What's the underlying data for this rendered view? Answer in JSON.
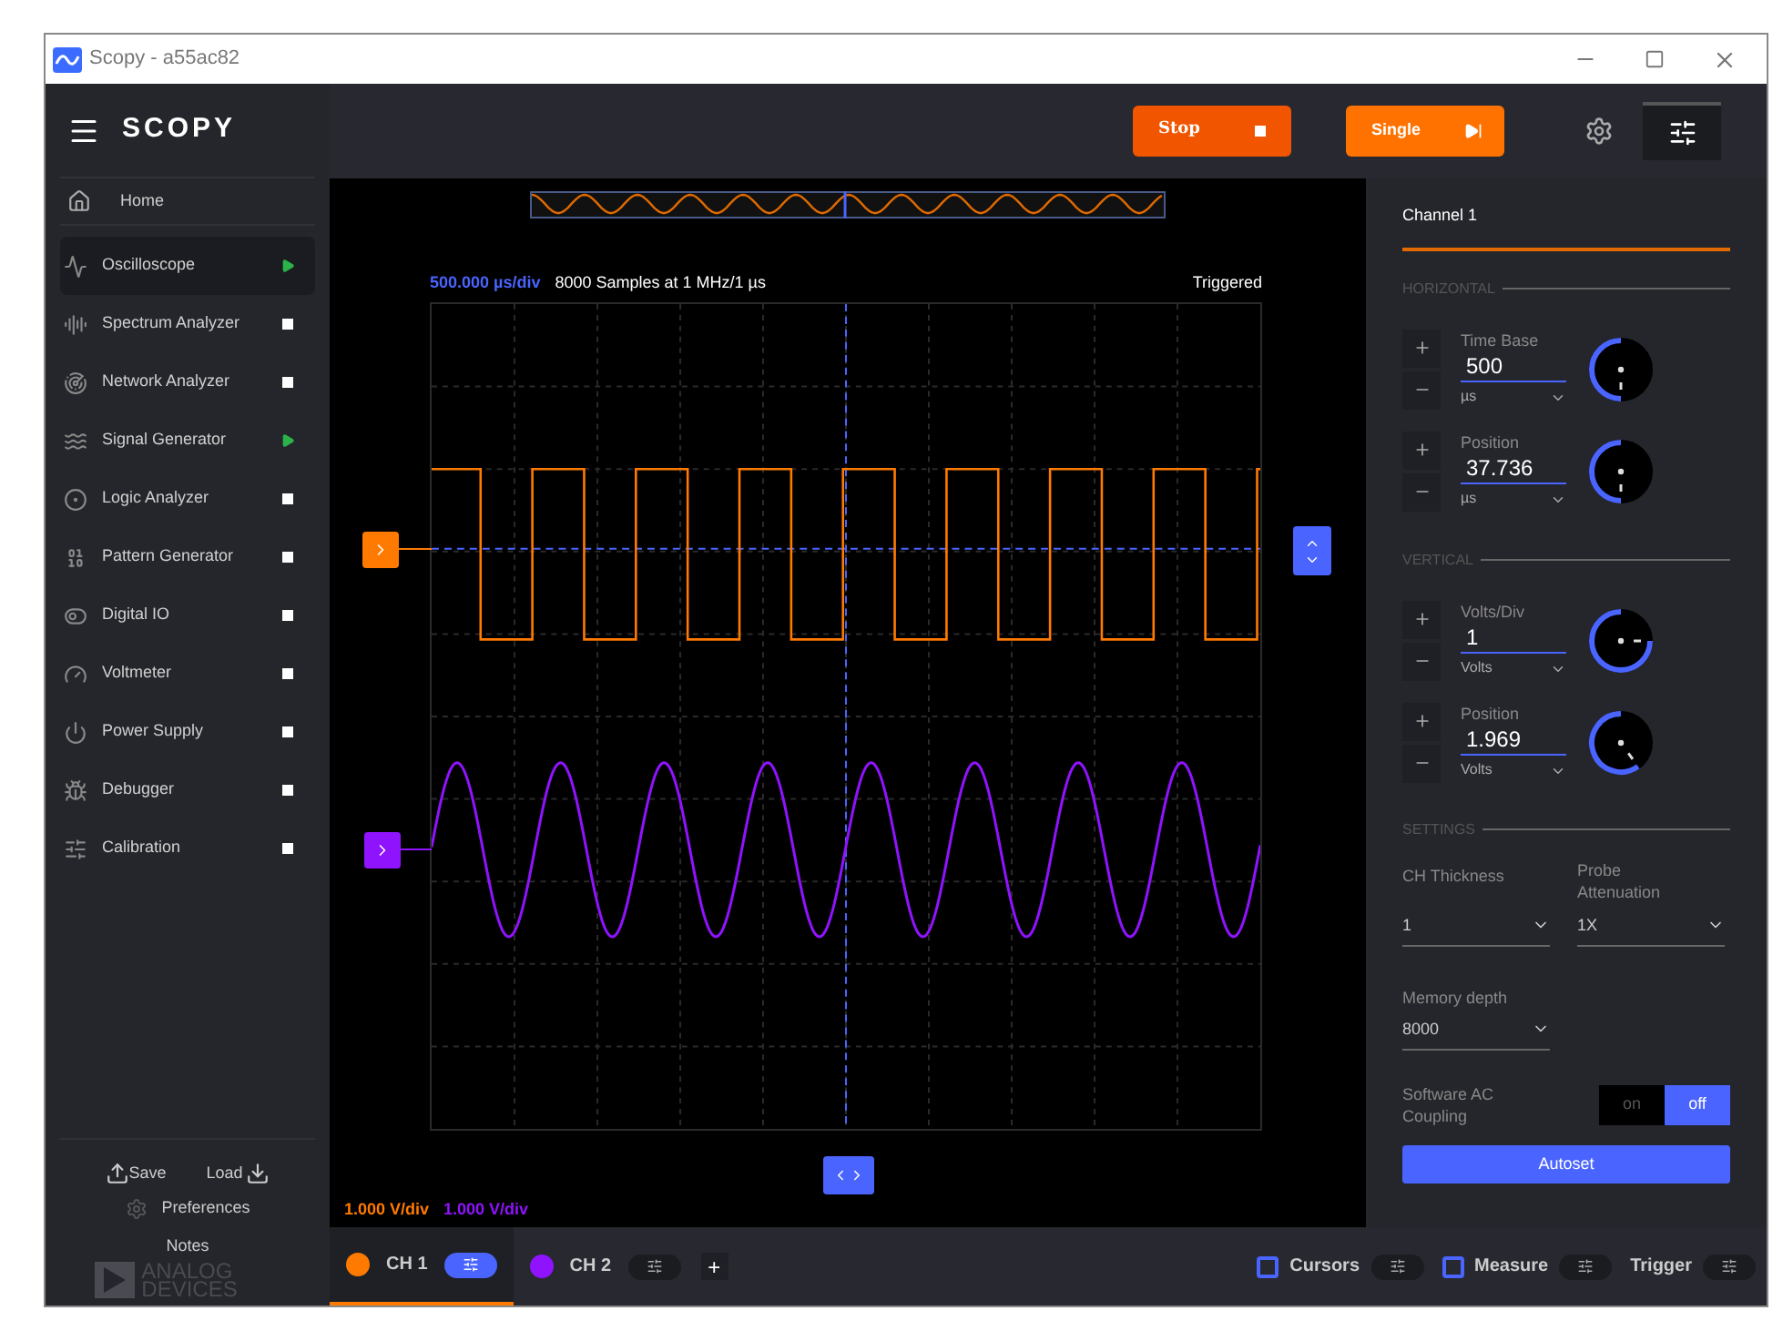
{
  "window": {
    "title": "Scopy - a55ac82"
  },
  "sidebar": {
    "logo": "SCOPY",
    "home": "Home",
    "tools": [
      {
        "label": "Oscilloscope",
        "kind": "oscilloscope",
        "selected": true,
        "running": true
      },
      {
        "label": "Spectrum Analyzer",
        "kind": "spectrum",
        "selected": false,
        "running": false
      },
      {
        "label": "Network Analyzer",
        "kind": "network",
        "selected": false,
        "running": false
      },
      {
        "label": "Signal Generator",
        "kind": "siggen",
        "selected": false,
        "running": true
      },
      {
        "label": "Logic Analyzer",
        "kind": "logic",
        "selected": false,
        "running": false
      },
      {
        "label": "Pattern Generator",
        "kind": "pattern",
        "selected": false,
        "running": false
      },
      {
        "label": "Digital IO",
        "kind": "dio",
        "selected": false,
        "running": false
      },
      {
        "label": "Voltmeter",
        "kind": "voltmeter",
        "selected": false,
        "running": false
      },
      {
        "label": "Power Supply",
        "kind": "power",
        "selected": false,
        "running": false
      },
      {
        "label": "Debugger",
        "kind": "debugger",
        "selected": false,
        "running": false
      },
      {
        "label": "Calibration",
        "kind": "calibration",
        "selected": false,
        "running": false
      }
    ],
    "save": "Save",
    "load": "Load",
    "preferences": "Preferences",
    "notes": "Notes",
    "brand": [
      "ANALOG",
      "DEVICES"
    ]
  },
  "toolbar": {
    "stop": "Stop",
    "single": "Single"
  },
  "plot": {
    "time_div": "500.000 µs/div",
    "samples": "8000 Samples at 1 MHz/1 µs",
    "status": "Triggered",
    "ch_scales": [
      {
        "text": "1.000 V/div",
        "color": "#ff7a00"
      },
      {
        "text": "1.000 V/div",
        "color": "#9013fe"
      }
    ]
  },
  "channel_panel": {
    "title": "Channel 1",
    "sections": [
      {
        "heading": "HORIZONTAL",
        "controls": [
          {
            "label": "Time Base",
            "value": "500",
            "unit": "µs"
          },
          {
            "label": "Position",
            "value": "37.736",
            "unit": "µs"
          }
        ]
      },
      {
        "heading": "VERTICAL",
        "controls": [
          {
            "label": "Volts/Div",
            "value": "1",
            "unit": "Volts"
          },
          {
            "label": "Position",
            "value": "1.969",
            "unit": "Volts"
          }
        ]
      }
    ],
    "settings_heading": "SETTINGS",
    "ch_thickness": {
      "label": "CH Thickness",
      "value": "1"
    },
    "probe": {
      "label": "Probe Attenuation",
      "value": "1X"
    },
    "memory": {
      "label": "Memory depth",
      "value": "8000"
    },
    "ac_coupling": {
      "label": "Software AC Coupling",
      "options": [
        {
          "label": "on",
          "selected": false
        },
        {
          "label": "off",
          "selected": true
        }
      ]
    },
    "autoset": "Autoset"
  },
  "bottom_bar": {
    "channels": [
      {
        "label": "CH 1",
        "color": "#ff7a00",
        "selected": true
      },
      {
        "label": "CH 2",
        "color": "#9013fe",
        "selected": false
      }
    ],
    "add": "+",
    "tools": [
      {
        "label": "Cursors",
        "kind": "checkbox",
        "checked": false
      },
      {
        "label": "Measure",
        "kind": "checkbox",
        "checked": false
      },
      {
        "label": "Trigger",
        "kind": "plain"
      }
    ]
  }
}
